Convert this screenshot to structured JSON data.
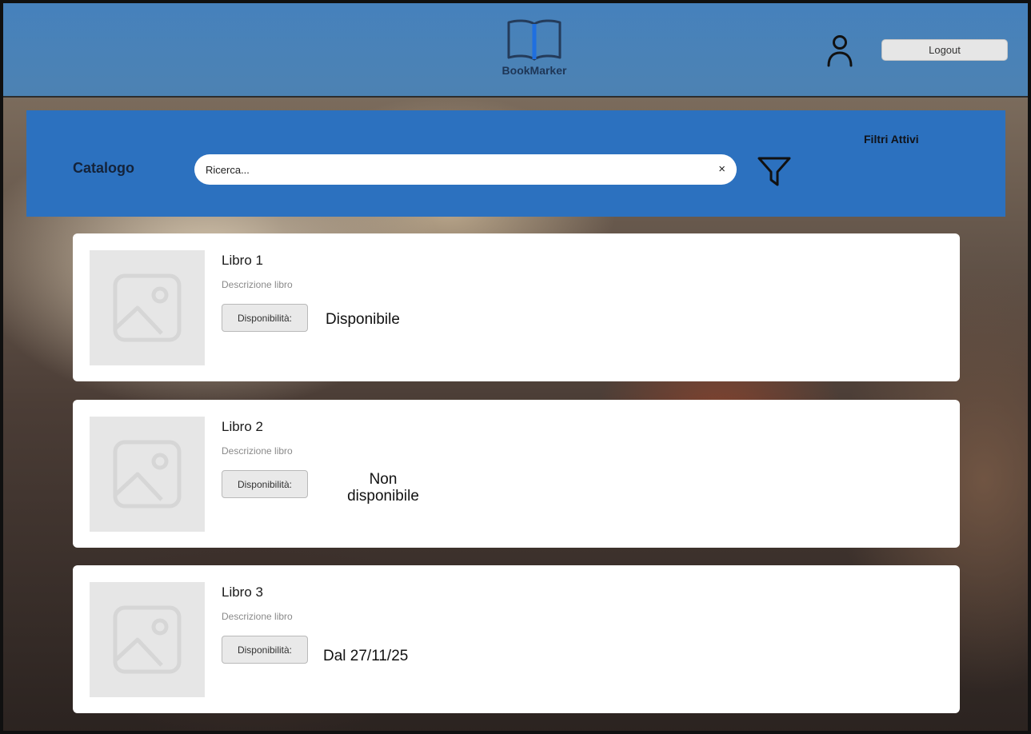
{
  "header": {
    "logo_text": "BookMarker",
    "logout_label": "Logout"
  },
  "toolbar": {
    "title": "Catalogo",
    "search_placeholder": "Ricerca...",
    "clear_symbol": "×",
    "active_filters_label": "Filtri Attivi"
  },
  "books": [
    {
      "title": "Libro 1",
      "description": "Descrizione libro",
      "availability_label": "Disponibilità:",
      "availability_value": "Disponibile"
    },
    {
      "title": "Libro 2",
      "description": "Descrizione libro",
      "availability_label": "Disponibilità:",
      "availability_value": "Non disponibile"
    },
    {
      "title": "Libro 3",
      "description": "Descrizione libro",
      "availability_label": "Disponibilità:",
      "availability_value": "Dal 27/11/25"
    }
  ],
  "icons": {
    "logo": "open-book-icon",
    "user": "user-icon",
    "filter": "filter-icon",
    "clear": "close-icon",
    "cover": "image-placeholder-icon"
  },
  "colors": {
    "header": "#3c82c8",
    "toolbar": "#2c71bf",
    "card": "#ffffff",
    "cover_placeholder": "#e6e6e6"
  }
}
